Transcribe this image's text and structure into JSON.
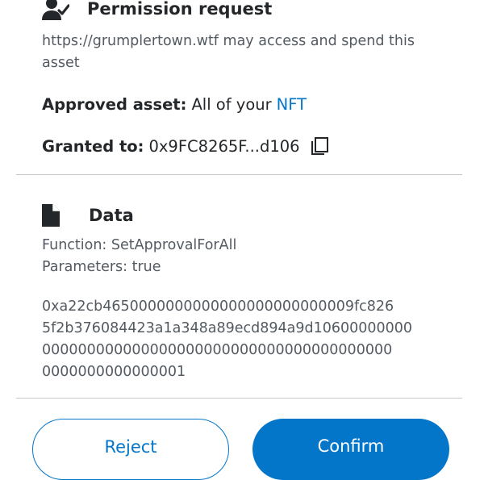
{
  "permission": {
    "title": "Permission request",
    "description": "https://grumplertown.wtf may access and spend this asset",
    "approved_asset_label": "Approved asset:",
    "approved_asset_prefix": "All of your",
    "approved_asset_link": "NFT",
    "granted_to_label": "Granted to:",
    "granted_to_address": "0x9FC8265F...d106",
    "icons": {
      "header": "user-check-icon",
      "copy": "copy-icon"
    }
  },
  "data_section": {
    "title": "Data",
    "function_line": "Function: SetApprovalForAll",
    "parameters_line": "Parameters: true",
    "hex_lines": [
      "0xa22cb4650000000000000000000000009fc826",
      "5f2b376084423a1a348a89ecd894a9d10600000000",
      "000000000000000000000000000000000000000",
      "0000000000000001"
    ],
    "icons": {
      "header": "document-icon"
    }
  },
  "actions": {
    "reject_label": "Reject",
    "confirm_label": "Confirm"
  },
  "colors": {
    "accent": "#0376c9",
    "text_primary": "#24272a",
    "text_secondary": "#535a61",
    "divider": "#c4c7ca"
  }
}
